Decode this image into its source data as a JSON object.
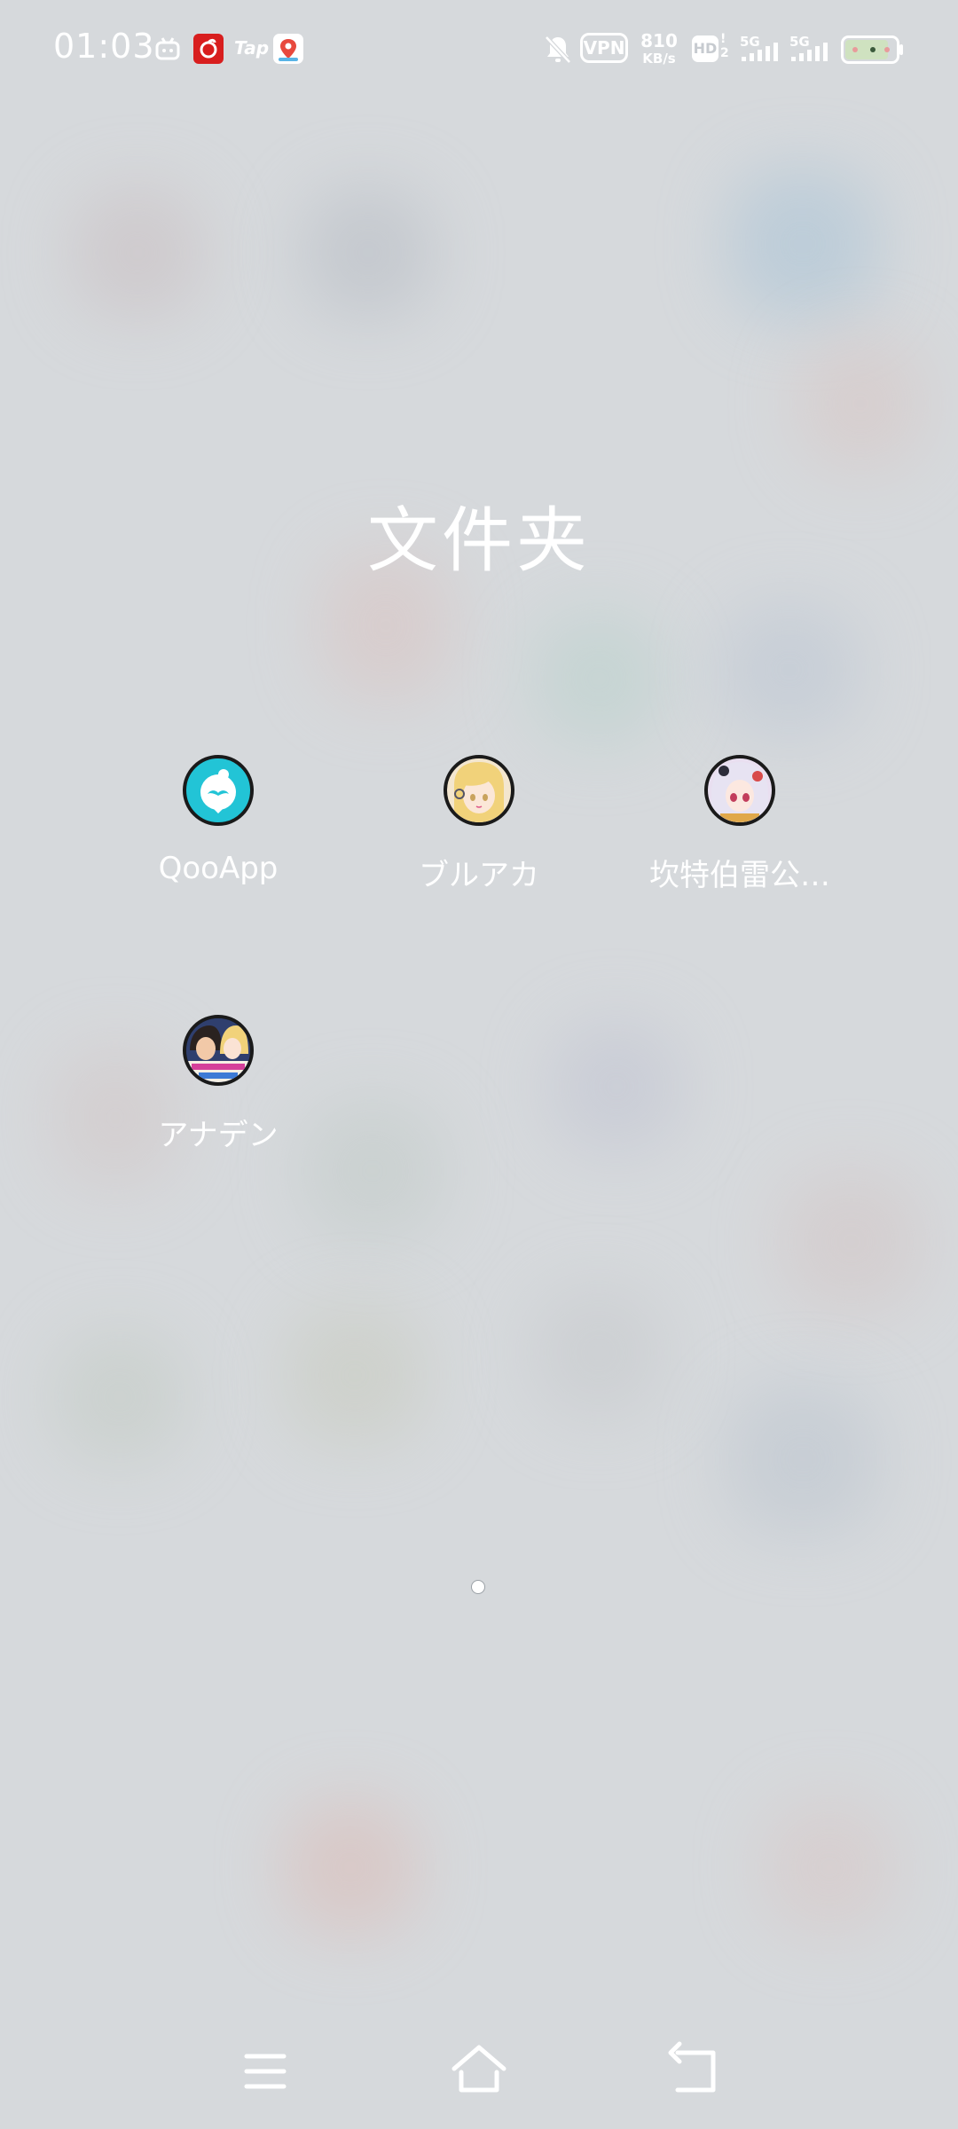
{
  "status_bar": {
    "time": "01:03",
    "notification_icons": [
      "bilibili-icon",
      "netease-music-icon",
      "taptap-icon",
      "map-pin-app-icon"
    ],
    "tap_text": "Tap",
    "silent": true,
    "vpn_label": "VPN",
    "net_speed_value": "810",
    "net_speed_unit": "KB/s",
    "hd_label": "HD",
    "sim1_label": "5G",
    "sim2_label": "5G",
    "battery_level": 0.85
  },
  "folder": {
    "title": "文件夹",
    "apps": [
      {
        "label": "QooApp",
        "icon": "qooapp-icon"
      },
      {
        "label": "ブルアカ",
        "icon": "bluearchive-icon"
      },
      {
        "label": "坎特伯雷公…",
        "icon": "canterbury-game-icon"
      },
      {
        "label": "アナデン",
        "icon": "anothereden-icon"
      }
    ]
  },
  "pager": {
    "pages": 1,
    "current": 1
  },
  "nav": {
    "buttons": [
      "menu-button",
      "home-button",
      "back-button"
    ]
  }
}
